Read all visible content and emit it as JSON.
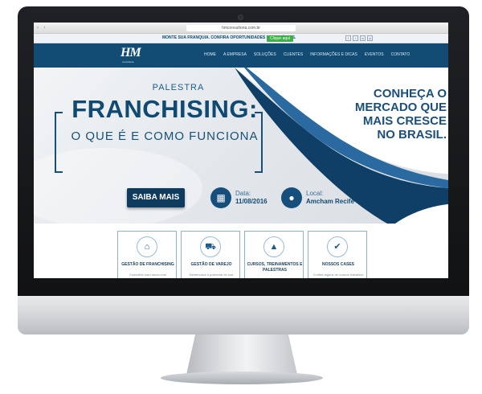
{
  "browser": {
    "url": "hmconsultoria.com.br",
    "nav_icons": [
      "back-icon",
      "forward-icon"
    ]
  },
  "topstrip": {
    "message": "MONTE SUA FRANQUIA. CONFIRA OPORTUNIDADES DE NEGÓCIOS.",
    "cta_label": "Clique aqui",
    "social": [
      "f",
      "t",
      "in",
      "yt"
    ]
  },
  "navbar": {
    "logo": "HM",
    "logo_sub": "consultoria",
    "menu": [
      "HOME",
      "A EMPRESA",
      "SOLUÇÕES",
      "CLIENTES",
      "INFORMAÇÕES E DICAS",
      "EVENTOS",
      "CONTATO"
    ]
  },
  "hero": {
    "kicker": "PALESTRA",
    "title": "FRANCHISING:",
    "subtitle": "O QUE É E COMO FUNCIONA",
    "right_headline_lines": [
      "CONHEÇA O",
      "MERCADO QUE",
      "MAIS CRESCE",
      "NO BRASIL."
    ],
    "cta": "SAIBA MAIS",
    "date_label": "Data:",
    "date_value": "11/08/2016",
    "place_label": "Local:",
    "place_value": "Amcham Recife",
    "colors": {
      "primary": "#124b74",
      "accent": "#3fae49"
    }
  },
  "features": [
    {
      "icon": "home-icon",
      "title": "GESTÃO DE FRANCHISING",
      "desc": "Consolide sua marca com"
    },
    {
      "icon": "cart-icon",
      "title": "GESTÃO DE VAREJO",
      "desc": "Desenvolva o potencial de sua"
    },
    {
      "icon": "graduation-cap-icon",
      "title": "CURSOS, TREINAMENTOS E PALESTRAS",
      "desc": ""
    },
    {
      "icon": "thumbs-up-icon",
      "title": "NOSSOS CASES",
      "desc": "Confira alguns de nossos trabalhos"
    }
  ]
}
